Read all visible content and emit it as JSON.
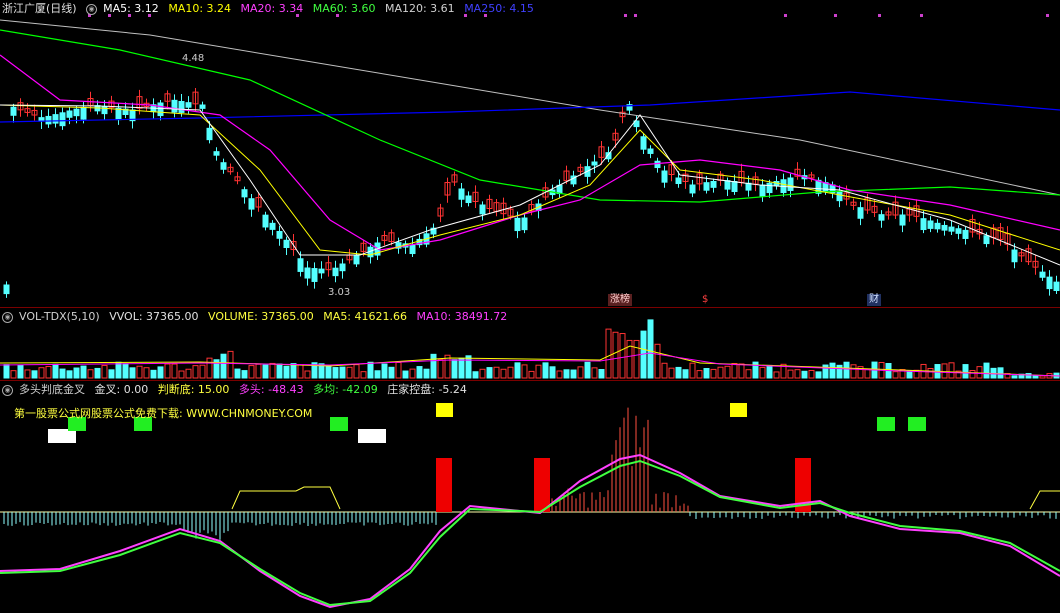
{
  "price_panel": {
    "header": {
      "security": "浙江广厦(日线)",
      "ma5": "MA5: 3.12",
      "ma10": "MA10: 3.24",
      "ma20": "MA20: 3.34",
      "ma60": "MA60: 3.60",
      "ma120": "MA120: 3.61",
      "ma250": "MA250: 4.15"
    },
    "high_label": "4.48",
    "low_label": "3.03",
    "event_tags": [
      "涨榜",
      "$",
      "财"
    ]
  },
  "volume_panel": {
    "header": {
      "indicator": "VOL-TDX(5,10)",
      "vvol": "VVOL: 37365.00",
      "volume": "VOLUME: 37365.00",
      "ma5": "MA5: 41621.66",
      "ma10": "MA10: 38491.72"
    }
  },
  "indicator_panel": {
    "header": {
      "indicator": "多头判底金叉",
      "golden_cross": "金叉: 0.00",
      "judge_bottom": "判断底: 15.00",
      "bull": "多头: -48.43",
      "avg": "多均: -42.09",
      "dealer": "庄家控盘: -5.24"
    },
    "promo": "第一股票公式网股票公式免费下载: WWW.CHNMONEY.COM"
  },
  "colors": {
    "up": "#ff3333",
    "down": "#54ffff",
    "ma5": "#ffffff",
    "ma10": "#ffff00",
    "ma20": "#ff00ff",
    "ma60": "#00ff00",
    "ma120": "#c0c0c0",
    "ma250": "#0000ff",
    "separator": "#7a0000"
  }
}
